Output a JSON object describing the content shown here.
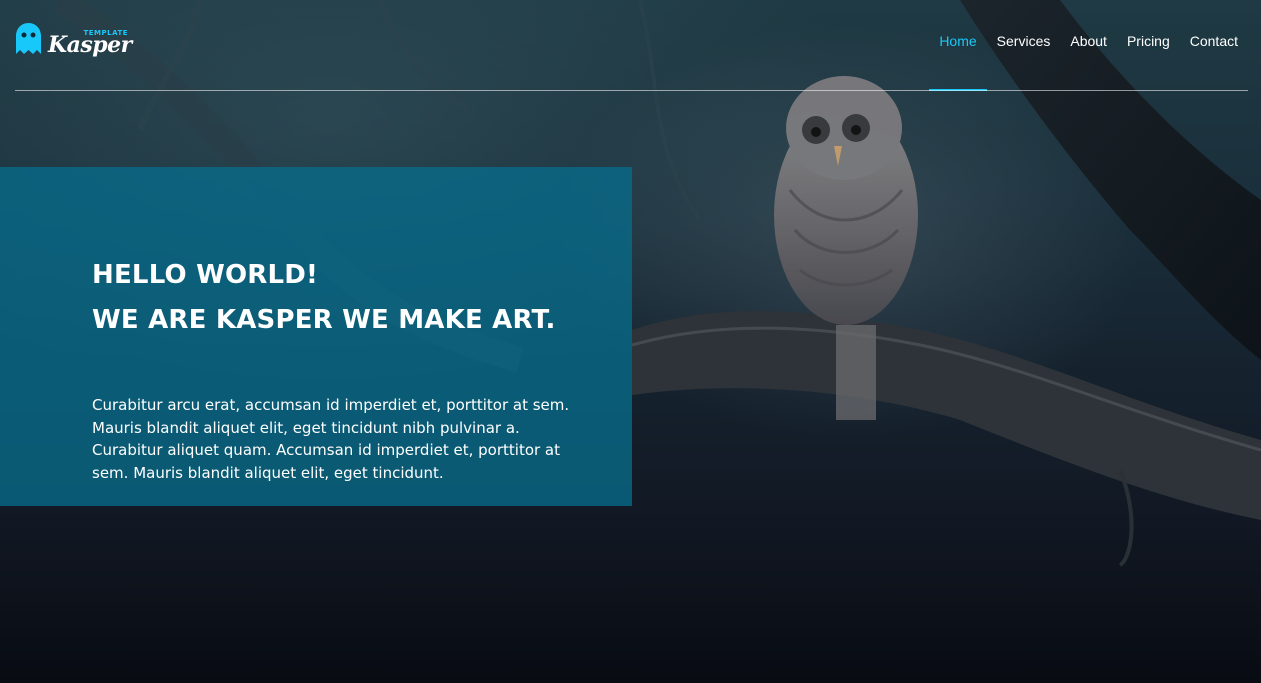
{
  "header": {
    "logo": {
      "name": "Kasper",
      "tagline": "TEMPLATE",
      "icon": "ghost-icon"
    },
    "nav": {
      "items": [
        {
          "label": "Home",
          "active": true
        },
        {
          "label": "Services",
          "active": false
        },
        {
          "label": "About",
          "active": false
        },
        {
          "label": "Pricing",
          "active": false
        },
        {
          "label": "Contact",
          "active": false
        }
      ]
    }
  },
  "intro": {
    "title_line1": "HELLO WORLD!",
    "title_line2": "WE ARE KASPER WE MAKE ART.",
    "text": "Curabitur arcu erat, accumsan id imperdiet et, porttitor at sem. Mauris blandit aliquet elit, eget tincidunt nibh pulvinar a. Curabitur aliquet quam. Accumsan id imperdiet et, porttitor at sem. Mauris blandit aliquet elit, eget tincidunt."
  },
  "colors": {
    "accent": "#19c8fa",
    "intro_overlay": "#086c8a",
    "text": "#ffffff"
  }
}
